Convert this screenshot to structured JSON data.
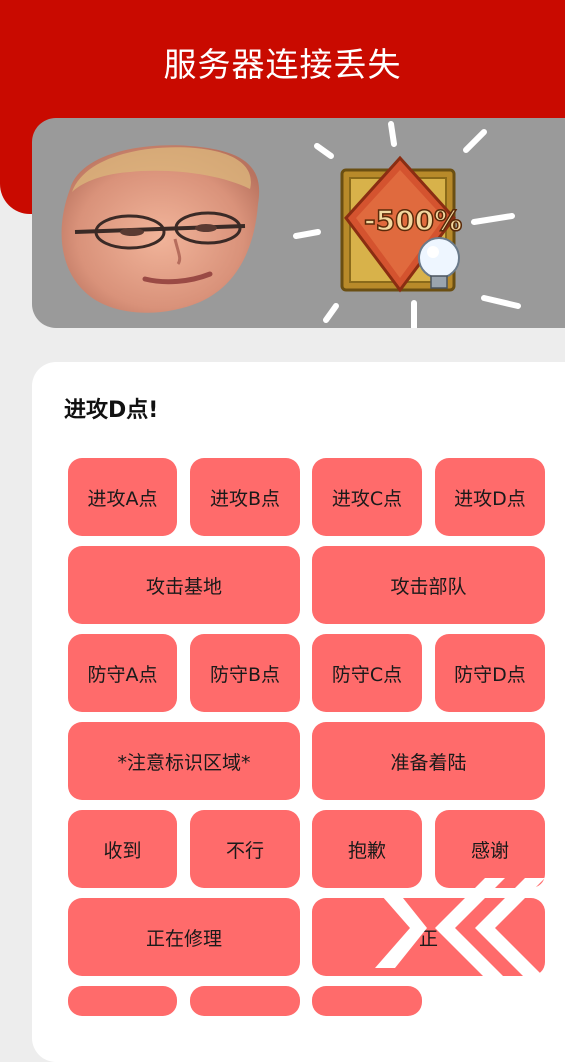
{
  "header": {
    "title": "服务器连接丢失"
  },
  "banner": {
    "badge_text": "-500%"
  },
  "current_command": "进攻D点!",
  "buttons": [
    "进攻A点",
    "进攻B点",
    "进攻C点",
    "进攻D点",
    "攻击基地",
    "攻击部队",
    "防守A点",
    "防守B点",
    "防守C点",
    "防守D点",
    "*注意标识区域*",
    "准备着陆",
    "收到",
    "不行",
    "抱歉",
    "感谢",
    "正在修理",
    "正"
  ],
  "colors": {
    "header": "#c90a00",
    "button": "#ff6b6b",
    "banner": "#9a9a9a"
  }
}
